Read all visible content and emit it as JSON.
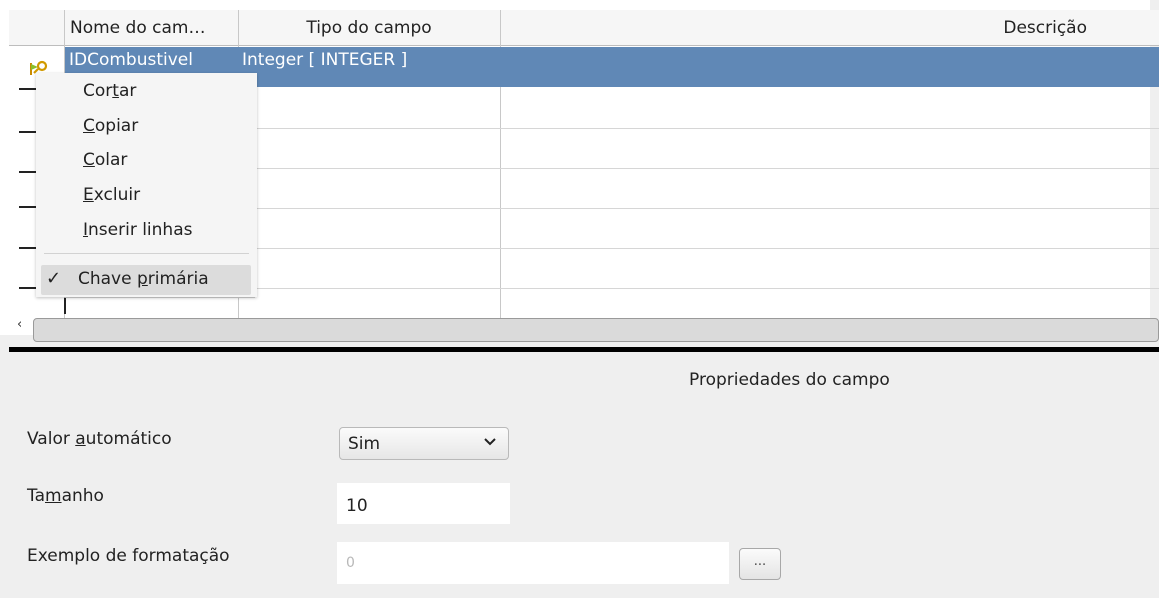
{
  "table": {
    "headers": {
      "name": "Nome do cam…",
      "type": "Tipo do campo",
      "description": "Descrição"
    },
    "selected_row": {
      "field_name": "IDCombustivel",
      "field_type": "Integer [ INTEGER ]",
      "icon": "primary-key-icon"
    }
  },
  "context_menu": {
    "items": [
      {
        "before": "Cor",
        "mnemonic": "t",
        "after": "ar"
      },
      {
        "before": "",
        "mnemonic": "C",
        "after": "opiar"
      },
      {
        "before": "",
        "mnemonic": "C",
        "after": "olar"
      },
      {
        "before": "",
        "mnemonic": "E",
        "after": "xcluir"
      },
      {
        "before": "",
        "mnemonic": "I",
        "after": "nserir linhas"
      },
      {
        "before": "Chave ",
        "mnemonic": "p",
        "after": "rimária",
        "checked": true,
        "check_glyph": "✓"
      }
    ]
  },
  "properties": {
    "title": "Propriedades do campo",
    "auto_value": {
      "label_before": "Valor ",
      "label_mnemonic": "a",
      "label_after": "utomático",
      "value": "Sim"
    },
    "size": {
      "label_before": "Ta",
      "label_mnemonic": "m",
      "label_after": "anho",
      "value": "10"
    },
    "format_example": {
      "label": "Exemplo de formatação",
      "value": "0",
      "button_label": "..."
    }
  },
  "colors": {
    "selection": "#6088b6",
    "background": "#efefef"
  }
}
